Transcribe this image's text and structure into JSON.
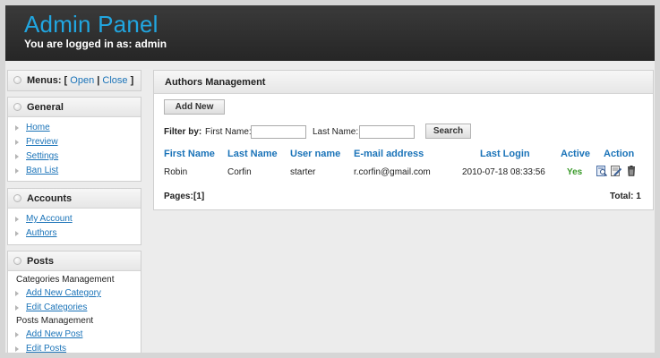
{
  "header": {
    "title": "Admin Panel",
    "login_text": "You are logged in as: admin"
  },
  "sidebar": {
    "menus_label": "Menus: [",
    "menus_open": "Open",
    "menus_sep": "|",
    "menus_close": "Close",
    "menus_end": "]",
    "general": {
      "title": "General",
      "items": [
        {
          "label": "Home"
        },
        {
          "label": "Preview"
        },
        {
          "label": "Settings"
        },
        {
          "label": "Ban List"
        }
      ]
    },
    "accounts": {
      "title": "Accounts",
      "items": [
        {
          "label": "My Account"
        },
        {
          "label": "Authors"
        }
      ]
    },
    "posts": {
      "title": "Posts",
      "categories_heading": "Categories Management",
      "categories_items": [
        {
          "label": "Add New Category"
        },
        {
          "label": "Edit Categories"
        }
      ],
      "posts_heading": "Posts Management",
      "posts_items": [
        {
          "label": "Add New Post"
        },
        {
          "label": "Edit Posts"
        }
      ]
    }
  },
  "main": {
    "title": "Authors Management",
    "add_new_label": "Add New",
    "filter": {
      "label": "Filter by:",
      "first_name_label": "First Name:",
      "first_name_value": "",
      "last_name_label": "Last Name:",
      "last_name_value": "",
      "search_label": "Search"
    },
    "table": {
      "columns": [
        "First Name",
        "Last Name",
        "User name",
        "E-mail address",
        "Last Login",
        "Active",
        "Action"
      ],
      "rows": [
        {
          "first_name": "Robin",
          "last_name": "Corfin",
          "user_name": "starter",
          "email": "r.corfin@gmail.com",
          "last_login": "2010-07-18 08:33:56",
          "active": "Yes",
          "actions": [
            "view-icon",
            "edit-icon",
            "delete-icon"
          ]
        }
      ]
    },
    "footer": {
      "pages_label": "Pages:",
      "pages_current": "[1]",
      "total_label": "Total: 1"
    }
  },
  "colors": {
    "header_bg": "#2e2e2e",
    "title_blue": "#21a6e0",
    "link_blue": "#1a73b8",
    "active_green": "#3a9a2a"
  }
}
